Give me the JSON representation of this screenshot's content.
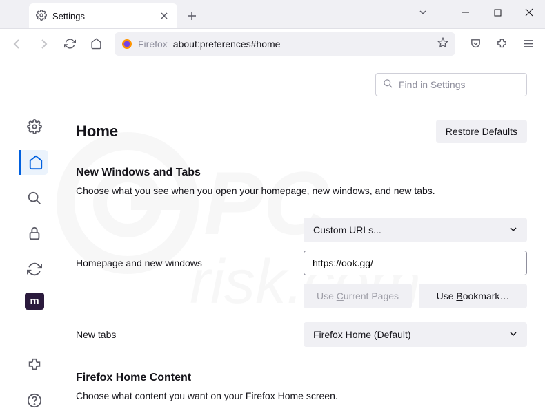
{
  "tab": {
    "title": "Settings"
  },
  "urlbar": {
    "brand": "Firefox",
    "url": "about:preferences#home"
  },
  "search": {
    "placeholder": "Find in Settings"
  },
  "page": {
    "title": "Home",
    "restore": "Restore Defaults",
    "section1": {
      "heading": "New Windows and Tabs",
      "desc": "Choose what you see when you open your homepage, new windows, and new tabs.",
      "homepage_label": "Homepage and new windows",
      "homepage_select": "Custom URLs...",
      "homepage_url": "https://ook.gg/",
      "use_current": "Use Current Pages",
      "use_bookmark": "Use Bookmark…",
      "newtabs_label": "New tabs",
      "newtabs_select": "Firefox Home (Default)"
    },
    "section2": {
      "heading": "Firefox Home Content",
      "desc": "Choose what content you want on your Firefox Home screen."
    }
  },
  "sidebar": {
    "items": [
      "general",
      "home",
      "search",
      "privacy",
      "sync",
      "m",
      "extensions",
      "help"
    ]
  }
}
